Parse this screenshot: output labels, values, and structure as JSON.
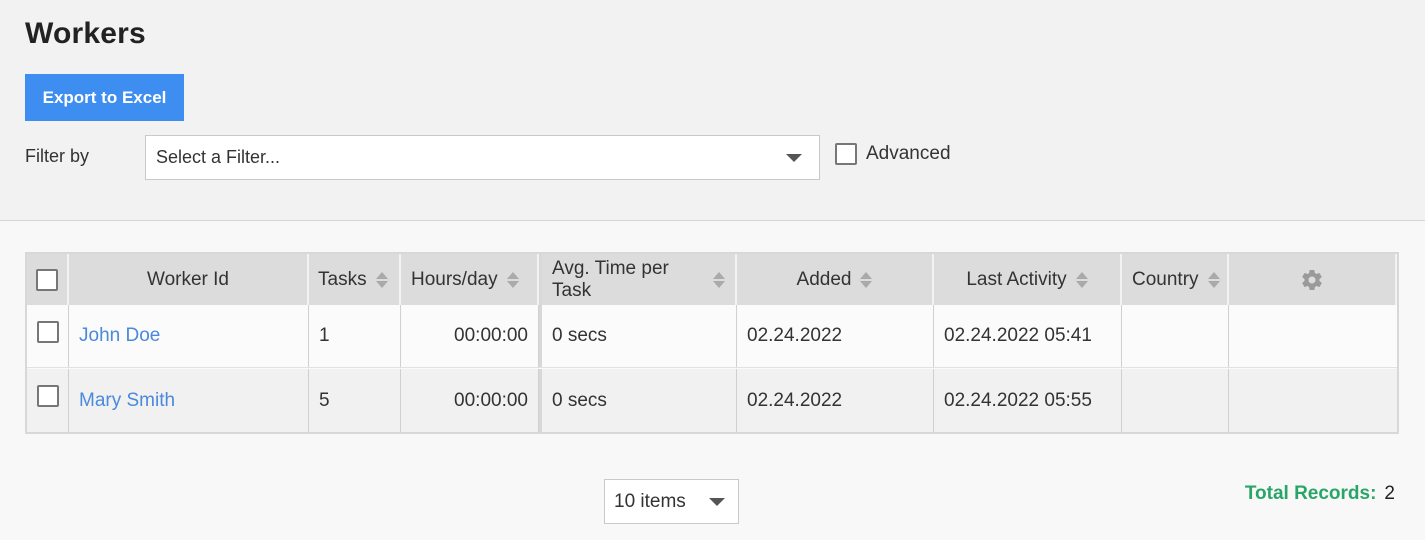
{
  "page": {
    "title": "Workers"
  },
  "toolbar": {
    "export_label": "Export to Excel"
  },
  "filter": {
    "label": "Filter by",
    "placeholder": "Select a Filter...",
    "advanced_label": "Advanced",
    "advanced_checked": false
  },
  "grid": {
    "columns": {
      "worker_id": "Worker Id",
      "tasks": "Tasks",
      "hours_per_day": "Hours/day",
      "avg_time": "Avg. Time per Task",
      "added": "Added",
      "last_activity": "Last Activity",
      "country": "Country"
    },
    "rows": [
      {
        "worker_id": "John Doe",
        "tasks": "1",
        "hours_per_day": "00:00:00",
        "avg_time": "0 secs",
        "added": "02.24.2022",
        "last_activity": "02.24.2022 05:41",
        "country": ""
      },
      {
        "worker_id": "Mary Smith",
        "tasks": "5",
        "hours_per_day": "00:00:00",
        "avg_time": "0 secs",
        "added": "02.24.2022",
        "last_activity": "02.24.2022 05:55",
        "country": ""
      }
    ]
  },
  "pager": {
    "page_size": "10 items"
  },
  "summary": {
    "total_label": "Total Records:",
    "total_value": "2"
  },
  "colors": {
    "accent": "#3d8ef0",
    "link": "#4a89dc",
    "success": "#2aa568"
  },
  "icons": {
    "settings": "gear-icon",
    "sort": "sort-arrows-icon",
    "dropdown": "chevron-down-icon"
  }
}
